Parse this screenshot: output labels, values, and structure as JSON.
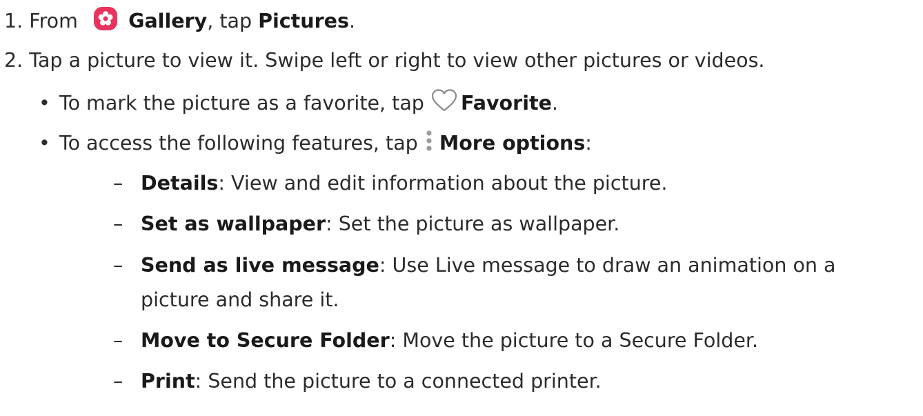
{
  "steps": [
    {
      "number": "1.",
      "pre": "From ",
      "icon": "gallery-icon",
      "target": "Gallery",
      "mid": ", tap ",
      "action": "Pictures",
      "post": "."
    },
    {
      "number": "2.",
      "text": "Tap a picture to view it. Swipe left or right to view other pictures or videos."
    }
  ],
  "bullets": [
    {
      "marker": "•",
      "pre": "To mark the picture as a favorite, tap ",
      "icon": "heart-icon",
      "label": "Favorite",
      "post": "."
    },
    {
      "marker": "•",
      "pre": "To access the following features, tap ",
      "icon": "more-options-icon",
      "label": "More options",
      "post": ":"
    }
  ],
  "options": [
    {
      "marker": "–",
      "term": "Details",
      "sep": ": ",
      "desc": "View and edit information about the picture."
    },
    {
      "marker": "–",
      "term": "Set as wallpaper",
      "sep": ": ",
      "desc": "Set the picture as wallpaper."
    },
    {
      "marker": "–",
      "term": "Send as live message",
      "sep": ": ",
      "desc": "Use Live message to draw an animation on a",
      "desc_cont": "picture and share it."
    },
    {
      "marker": "–",
      "term": "Move to Secure Folder",
      "sep": ": ",
      "desc": "Move the picture to a Secure Folder."
    },
    {
      "marker": "–",
      "term": "Print",
      "sep": ": ",
      "desc": "Send the picture to a connected printer."
    }
  ],
  "colors": {
    "gallery_icon_bg": "#e8335f",
    "heart_stroke": "#8a8a8a",
    "more_dots": "#9a9a9a",
    "text": "#2b2b2b"
  }
}
